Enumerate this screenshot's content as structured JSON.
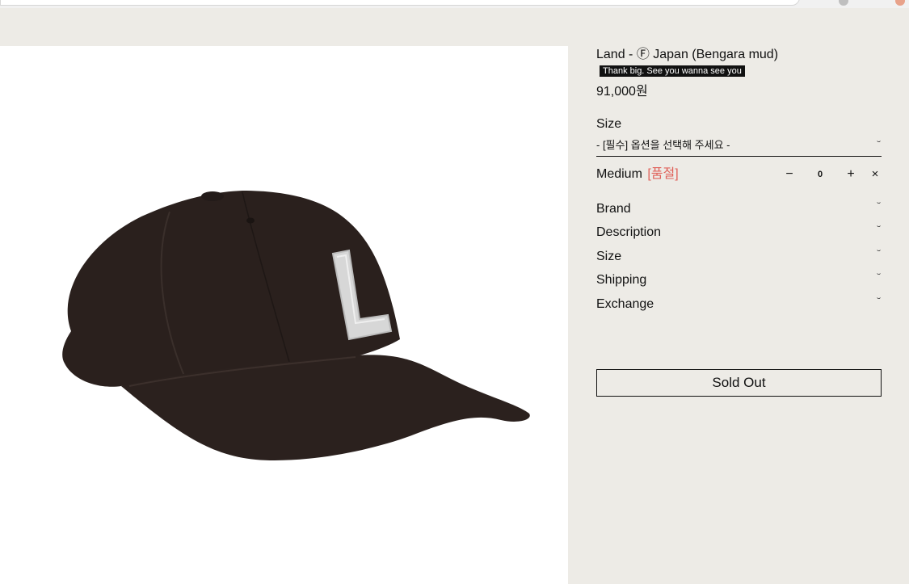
{
  "product": {
    "title": "Land - Ⓕ Japan (Bengara mud)",
    "tooltip": "Thank big. See you wanna see you",
    "price": "91,000원",
    "image_alt": "Black baseball cap with white L logo"
  },
  "size_select": {
    "label": "Size",
    "placeholder": "- [필수] 옵션을 선택해 주세요 -",
    "chevron": "chevron-down-icon"
  },
  "option": {
    "name": "Medium",
    "status": "[품절]",
    "quantity": "0",
    "minus": "−",
    "plus": "+",
    "remove": "×"
  },
  "accordion": [
    {
      "label": "Brand"
    },
    {
      "label": "Description"
    },
    {
      "label": "Size"
    },
    {
      "label": "Shipping"
    },
    {
      "label": "Exchange"
    }
  ],
  "chevron_glyph": "ˇ",
  "soldout_label": "Sold Out",
  "colors": {
    "page_bg": "#edebe6",
    "soldout_tag": "#e0625a",
    "cap": "#2a201d"
  }
}
